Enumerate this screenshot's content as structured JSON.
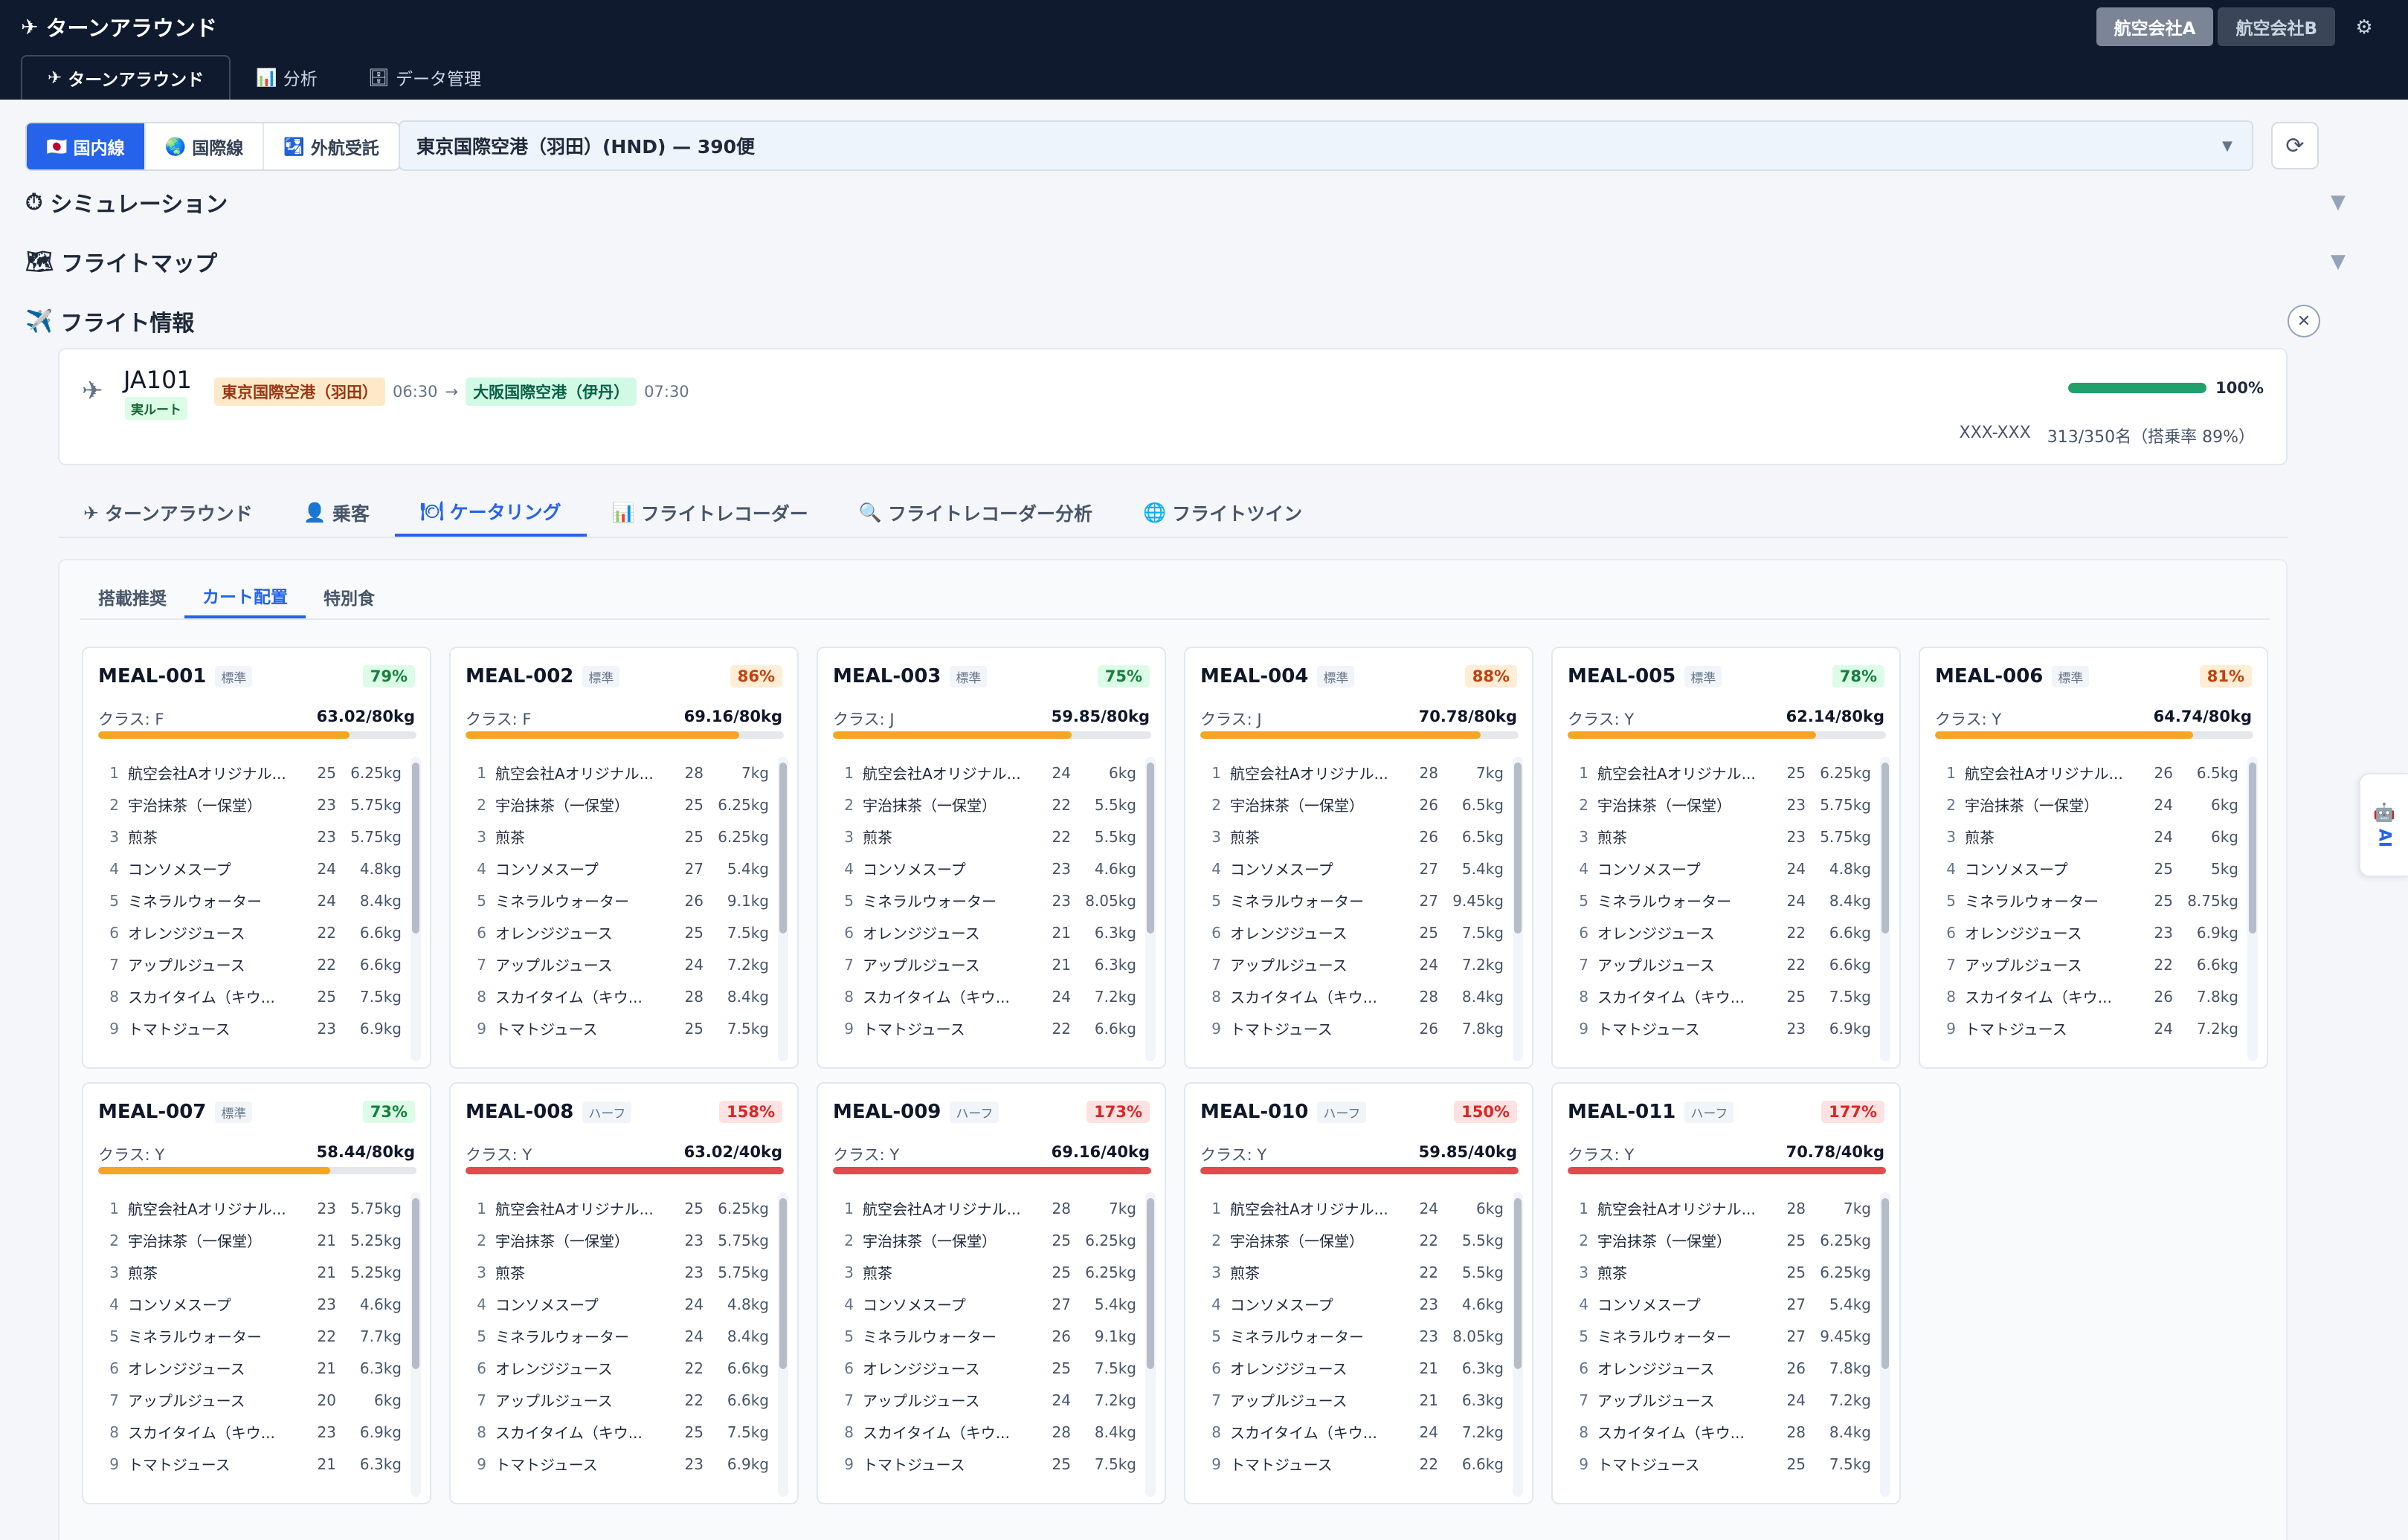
{
  "header": {
    "title": "ターンアラウンド",
    "airlines": [
      "航空会社A",
      "航空会社B"
    ],
    "active_airline": "航空会社A"
  },
  "main_tabs": [
    {
      "icon": "✈",
      "label": "ターンアラウンド"
    },
    {
      "icon": "📊",
      "label": "分析"
    },
    {
      "icon": "🗄",
      "label": "データ管理"
    }
  ],
  "region_tabs": [
    {
      "icon": "🇯🇵",
      "label": "国内線"
    },
    {
      "icon": "🌏",
      "label": "国際線"
    },
    {
      "icon": "🛂",
      "label": "外航受託"
    }
  ],
  "airport_select": {
    "value": "東京国際空港（羽田）(HND) — 390便"
  },
  "sections": {
    "simulation": "シミュレーション",
    "flight_map": "フライトマップ",
    "flight_info": "フライト情報"
  },
  "flight": {
    "number": "JA101",
    "route_badge": "実ルート",
    "from": "東京国際空港（羽田）",
    "dep_time": "06:30",
    "arrow": "→",
    "to": "大阪国際空港（伊丹）",
    "arr_time": "07:30",
    "progress_pct": 100,
    "progress_label": "100%",
    "aircraft": "XXX-XXX",
    "load": "313/350名（搭乗率 89%）"
  },
  "sub_tabs": [
    {
      "icon": "✈",
      "label": "ターンアラウンド"
    },
    {
      "icon": "👤",
      "label": "乗客"
    },
    {
      "icon": "🍽",
      "label": "ケータリング"
    },
    {
      "icon": "📊",
      "label": "フライトレコーダー"
    },
    {
      "icon": "🔍",
      "label": "フライトレコーダー分析"
    },
    {
      "icon": "🌐",
      "label": "フライトツイン"
    }
  ],
  "catering_tabs": [
    "搭載推奨",
    "カート配置",
    "特別食"
  ],
  "ai_tab_label": "AI",
  "colors": {
    "accent": "#2563eb",
    "header_bg": "#0f1a2e",
    "bar_orange": "#f5a524",
    "bar_red": "#e5484d",
    "progress_green": "#22a06b"
  },
  "meals": [
    {
      "id": "MEAL-001",
      "type": "標準",
      "pct": "79%",
      "pct_level": "green",
      "class": "クラス: F",
      "weight": "63.02/80kg",
      "fill": 0.79,
      "items": [
        [
          "1",
          "航空会社Aオリジナル...",
          "25",
          "6.25kg"
        ],
        [
          "2",
          "宇治抹茶（一保堂）",
          "23",
          "5.75kg"
        ],
        [
          "3",
          "煎茶",
          "23",
          "5.75kg"
        ],
        [
          "4",
          "コンソメスープ",
          "24",
          "4.8kg"
        ],
        [
          "5",
          "ミネラルウォーター",
          "24",
          "8.4kg"
        ],
        [
          "6",
          "オレンジジュース",
          "22",
          "6.6kg"
        ],
        [
          "7",
          "アップルジュース",
          "22",
          "6.6kg"
        ],
        [
          "8",
          "スカイタイム（キウ...",
          "25",
          "7.5kg"
        ],
        [
          "9",
          "トマトジュース",
          "23",
          "6.9kg"
        ]
      ]
    },
    {
      "id": "MEAL-002",
      "type": "標準",
      "pct": "86%",
      "pct_level": "orange",
      "class": "クラス: F",
      "weight": "69.16/80kg",
      "fill": 0.86,
      "items": [
        [
          "1",
          "航空会社Aオリジナル...",
          "28",
          "7kg"
        ],
        [
          "2",
          "宇治抹茶（一保堂）",
          "25",
          "6.25kg"
        ],
        [
          "3",
          "煎茶",
          "25",
          "6.25kg"
        ],
        [
          "4",
          "コンソメスープ",
          "27",
          "5.4kg"
        ],
        [
          "5",
          "ミネラルウォーター",
          "26",
          "9.1kg"
        ],
        [
          "6",
          "オレンジジュース",
          "25",
          "7.5kg"
        ],
        [
          "7",
          "アップルジュース",
          "24",
          "7.2kg"
        ],
        [
          "8",
          "スカイタイム（キウ...",
          "28",
          "8.4kg"
        ],
        [
          "9",
          "トマトジュース",
          "25",
          "7.5kg"
        ]
      ]
    },
    {
      "id": "MEAL-003",
      "type": "標準",
      "pct": "75%",
      "pct_level": "green",
      "class": "クラス: J",
      "weight": "59.85/80kg",
      "fill": 0.75,
      "items": [
        [
          "1",
          "航空会社Aオリジナル...",
          "24",
          "6kg"
        ],
        [
          "2",
          "宇治抹茶（一保堂）",
          "22",
          "5.5kg"
        ],
        [
          "3",
          "煎茶",
          "22",
          "5.5kg"
        ],
        [
          "4",
          "コンソメスープ",
          "23",
          "4.6kg"
        ],
        [
          "5",
          "ミネラルウォーター",
          "23",
          "8.05kg"
        ],
        [
          "6",
          "オレンジジュース",
          "21",
          "6.3kg"
        ],
        [
          "7",
          "アップルジュース",
          "21",
          "6.3kg"
        ],
        [
          "8",
          "スカイタイム（キウ...",
          "24",
          "7.2kg"
        ],
        [
          "9",
          "トマトジュース",
          "22",
          "6.6kg"
        ]
      ]
    },
    {
      "id": "MEAL-004",
      "type": "標準",
      "pct": "88%",
      "pct_level": "orange",
      "class": "クラス: J",
      "weight": "70.78/80kg",
      "fill": 0.88,
      "items": [
        [
          "1",
          "航空会社Aオリジナル...",
          "28",
          "7kg"
        ],
        [
          "2",
          "宇治抹茶（一保堂）",
          "26",
          "6.5kg"
        ],
        [
          "3",
          "煎茶",
          "26",
          "6.5kg"
        ],
        [
          "4",
          "コンソメスープ",
          "27",
          "5.4kg"
        ],
        [
          "5",
          "ミネラルウォーター",
          "27",
          "9.45kg"
        ],
        [
          "6",
          "オレンジジュース",
          "25",
          "7.5kg"
        ],
        [
          "7",
          "アップルジュース",
          "24",
          "7.2kg"
        ],
        [
          "8",
          "スカイタイム（キウ...",
          "28",
          "8.4kg"
        ],
        [
          "9",
          "トマトジュース",
          "26",
          "7.8kg"
        ]
      ]
    },
    {
      "id": "MEAL-005",
      "type": "標準",
      "pct": "78%",
      "pct_level": "green",
      "class": "クラス: Y",
      "weight": "62.14/80kg",
      "fill": 0.78,
      "items": [
        [
          "1",
          "航空会社Aオリジナル...",
          "25",
          "6.25kg"
        ],
        [
          "2",
          "宇治抹茶（一保堂）",
          "23",
          "5.75kg"
        ],
        [
          "3",
          "煎茶",
          "23",
          "5.75kg"
        ],
        [
          "4",
          "コンソメスープ",
          "24",
          "4.8kg"
        ],
        [
          "5",
          "ミネラルウォーター",
          "24",
          "8.4kg"
        ],
        [
          "6",
          "オレンジジュース",
          "22",
          "6.6kg"
        ],
        [
          "7",
          "アップルジュース",
          "22",
          "6.6kg"
        ],
        [
          "8",
          "スカイタイム（キウ...",
          "25",
          "7.5kg"
        ],
        [
          "9",
          "トマトジュース",
          "23",
          "6.9kg"
        ]
      ]
    },
    {
      "id": "MEAL-006",
      "type": "標準",
      "pct": "81%",
      "pct_level": "orange",
      "class": "クラス: Y",
      "weight": "64.74/80kg",
      "fill": 0.81,
      "items": [
        [
          "1",
          "航空会社Aオリジナル...",
          "26",
          "6.5kg"
        ],
        [
          "2",
          "宇治抹茶（一保堂）",
          "24",
          "6kg"
        ],
        [
          "3",
          "煎茶",
          "24",
          "6kg"
        ],
        [
          "4",
          "コンソメスープ",
          "25",
          "5kg"
        ],
        [
          "5",
          "ミネラルウォーター",
          "25",
          "8.75kg"
        ],
        [
          "6",
          "オレンジジュース",
          "23",
          "6.9kg"
        ],
        [
          "7",
          "アップルジュース",
          "22",
          "6.6kg"
        ],
        [
          "8",
          "スカイタイム（キウ...",
          "26",
          "7.8kg"
        ],
        [
          "9",
          "トマトジュース",
          "24",
          "7.2kg"
        ]
      ]
    },
    {
      "id": "MEAL-007",
      "type": "標準",
      "pct": "73%",
      "pct_level": "green",
      "class": "クラス: Y",
      "weight": "58.44/80kg",
      "fill": 0.73,
      "items": [
        [
          "1",
          "航空会社Aオリジナル...",
          "23",
          "5.75kg"
        ],
        [
          "2",
          "宇治抹茶（一保堂）",
          "21",
          "5.25kg"
        ],
        [
          "3",
          "煎茶",
          "21",
          "5.25kg"
        ],
        [
          "4",
          "コンソメスープ",
          "23",
          "4.6kg"
        ],
        [
          "5",
          "ミネラルウォーター",
          "22",
          "7.7kg"
        ],
        [
          "6",
          "オレンジジュース",
          "21",
          "6.3kg"
        ],
        [
          "7",
          "アップルジュース",
          "20",
          "6kg"
        ],
        [
          "8",
          "スカイタイム（キウ...",
          "23",
          "6.9kg"
        ],
        [
          "9",
          "トマトジュース",
          "21",
          "6.3kg"
        ]
      ]
    },
    {
      "id": "MEAL-008",
      "type": "ハーフ",
      "pct": "158%",
      "pct_level": "red",
      "class": "クラス: Y",
      "weight": "63.02/40kg",
      "fill": 1,
      "items": [
        [
          "1",
          "航空会社Aオリジナル...",
          "25",
          "6.25kg"
        ],
        [
          "2",
          "宇治抹茶（一保堂）",
          "23",
          "5.75kg"
        ],
        [
          "3",
          "煎茶",
          "23",
          "5.75kg"
        ],
        [
          "4",
          "コンソメスープ",
          "24",
          "4.8kg"
        ],
        [
          "5",
          "ミネラルウォーター",
          "24",
          "8.4kg"
        ],
        [
          "6",
          "オレンジジュース",
          "22",
          "6.6kg"
        ],
        [
          "7",
          "アップルジュース",
          "22",
          "6.6kg"
        ],
        [
          "8",
          "スカイタイム（キウ...",
          "25",
          "7.5kg"
        ],
        [
          "9",
          "トマトジュース",
          "23",
          "6.9kg"
        ]
      ]
    },
    {
      "id": "MEAL-009",
      "type": "ハーフ",
      "pct": "173%",
      "pct_level": "red",
      "class": "クラス: Y",
      "weight": "69.16/40kg",
      "fill": 1,
      "items": [
        [
          "1",
          "航空会社Aオリジナル...",
          "28",
          "7kg"
        ],
        [
          "2",
          "宇治抹茶（一保堂）",
          "25",
          "6.25kg"
        ],
        [
          "3",
          "煎茶",
          "25",
          "6.25kg"
        ],
        [
          "4",
          "コンソメスープ",
          "27",
          "5.4kg"
        ],
        [
          "5",
          "ミネラルウォーター",
          "26",
          "9.1kg"
        ],
        [
          "6",
          "オレンジジュース",
          "25",
          "7.5kg"
        ],
        [
          "7",
          "アップルジュース",
          "24",
          "7.2kg"
        ],
        [
          "8",
          "スカイタイム（キウ...",
          "28",
          "8.4kg"
        ],
        [
          "9",
          "トマトジュース",
          "25",
          "7.5kg"
        ]
      ]
    },
    {
      "id": "MEAL-010",
      "type": "ハーフ",
      "pct": "150%",
      "pct_level": "red",
      "class": "クラス: Y",
      "weight": "59.85/40kg",
      "fill": 1,
      "items": [
        [
          "1",
          "航空会社Aオリジナル...",
          "24",
          "6kg"
        ],
        [
          "2",
          "宇治抹茶（一保堂）",
          "22",
          "5.5kg"
        ],
        [
          "3",
          "煎茶",
          "22",
          "5.5kg"
        ],
        [
          "4",
          "コンソメスープ",
          "23",
          "4.6kg"
        ],
        [
          "5",
          "ミネラルウォーター",
          "23",
          "8.05kg"
        ],
        [
          "6",
          "オレンジジュース",
          "21",
          "6.3kg"
        ],
        [
          "7",
          "アップルジュース",
          "21",
          "6.3kg"
        ],
        [
          "8",
          "スカイタイム（キウ...",
          "24",
          "7.2kg"
        ],
        [
          "9",
          "トマトジュース",
          "22",
          "6.6kg"
        ]
      ]
    },
    {
      "id": "MEAL-011",
      "type": "ハーフ",
      "pct": "177%",
      "pct_level": "red",
      "class": "クラス: Y",
      "weight": "70.78/40kg",
      "fill": 1,
      "items": [
        [
          "1",
          "航空会社Aオリジナル...",
          "28",
          "7kg"
        ],
        [
          "2",
          "宇治抹茶（一保堂）",
          "25",
          "6.25kg"
        ],
        [
          "3",
          "煎茶",
          "25",
          "6.25kg"
        ],
        [
          "4",
          "コンソメスープ",
          "27",
          "5.4kg"
        ],
        [
          "5",
          "ミネラルウォーター",
          "27",
          "9.45kg"
        ],
        [
          "6",
          "オレンジジュース",
          "26",
          "7.8kg"
        ],
        [
          "7",
          "アップルジュース",
          "24",
          "7.2kg"
        ],
        [
          "8",
          "スカイタイム（キウ...",
          "28",
          "8.4kg"
        ],
        [
          "9",
          "トマトジュース",
          "25",
          "7.5kg"
        ]
      ]
    }
  ]
}
